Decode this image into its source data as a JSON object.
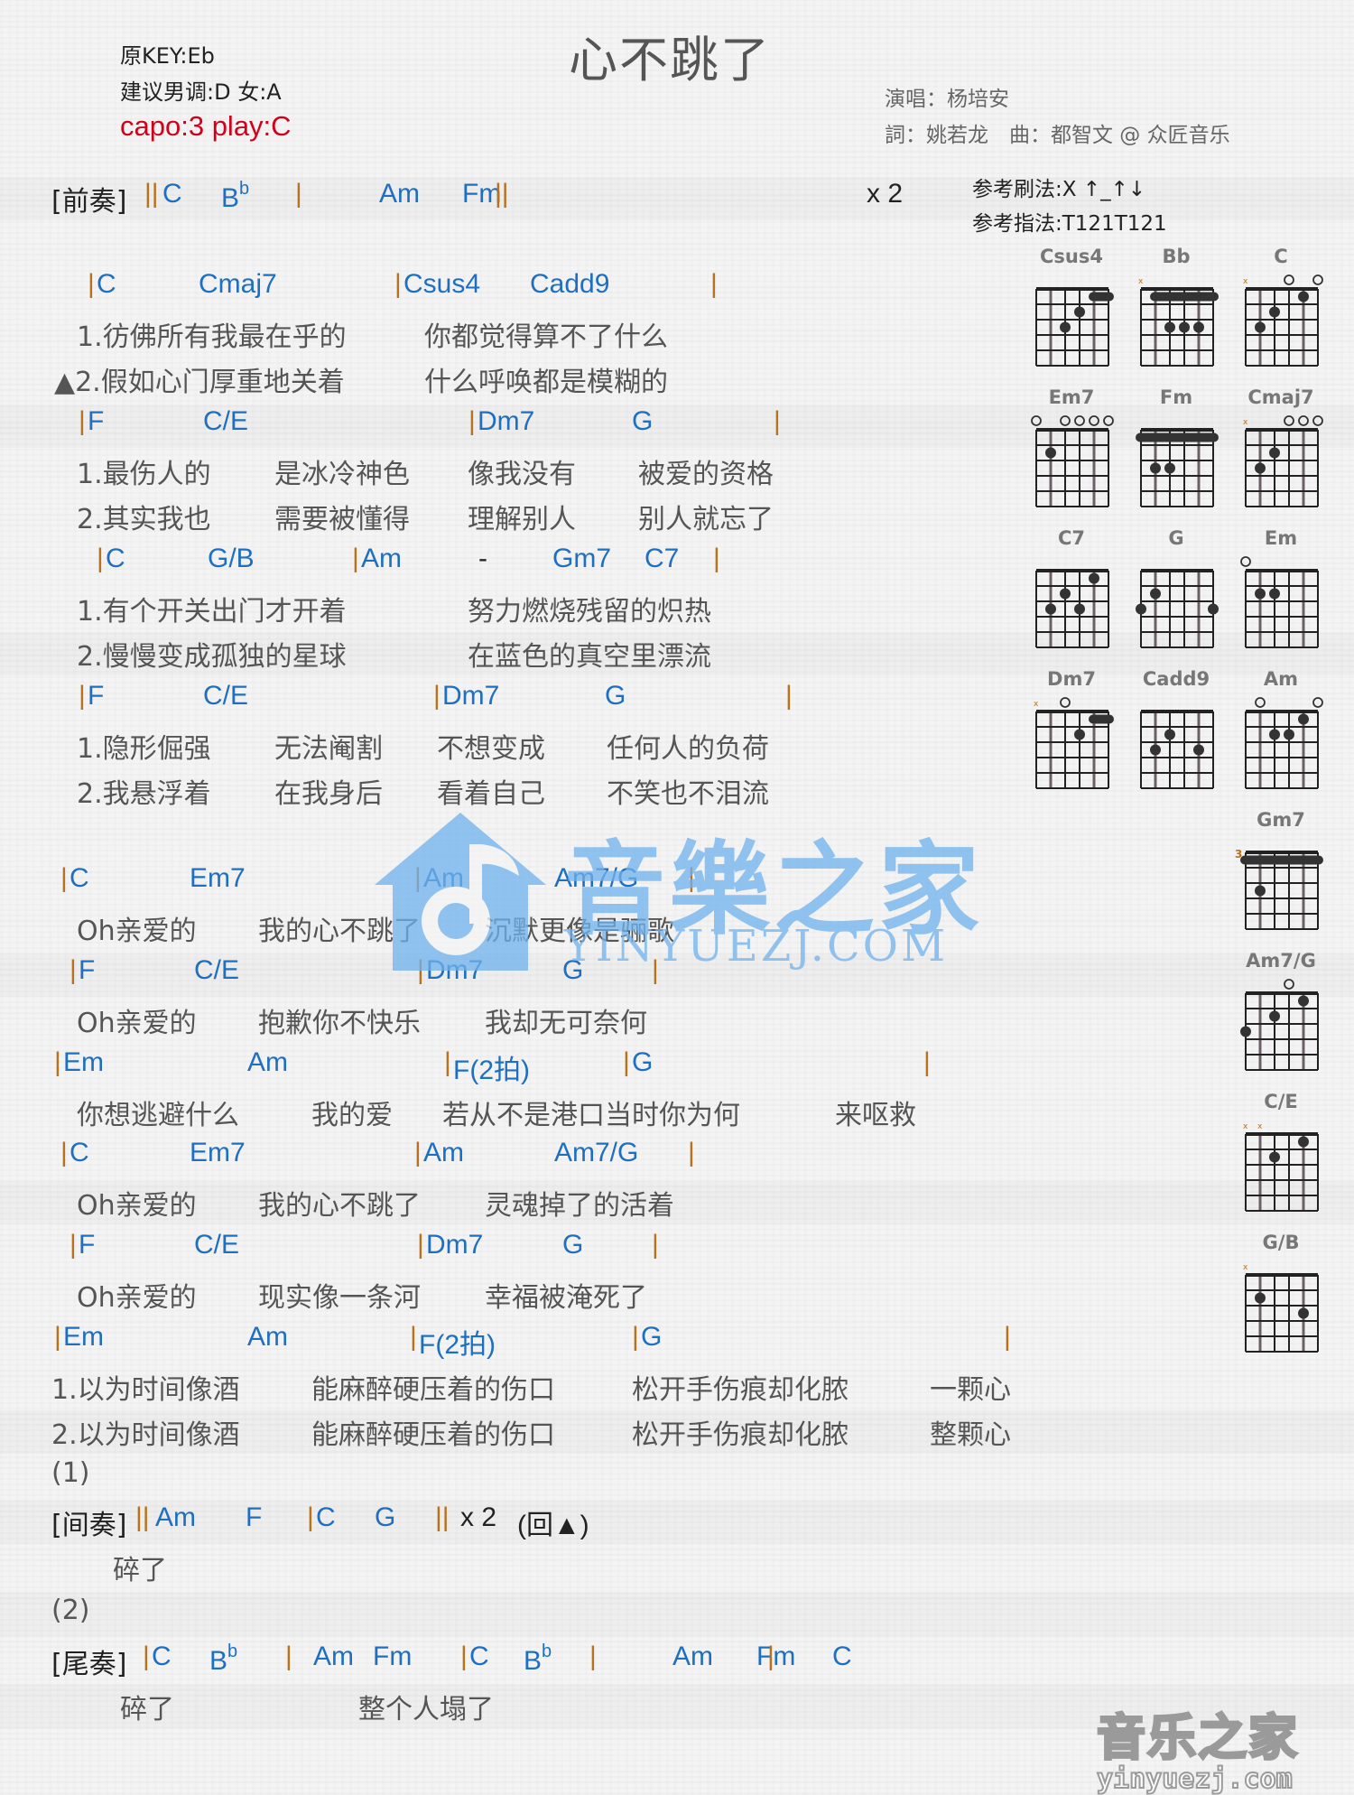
{
  "header": {
    "original_key": "原KEY:Eb",
    "suggested_key": "建议男调:D 女:A",
    "capo": "capo:3 play:C",
    "title": "心不跳了",
    "singer": "演唱：杨培安",
    "credits": "詞：姚若龙　曲：都智文 @ 众匠音乐",
    "strum": "参考刷法:X ↑_↑↓",
    "finger": "参考指法:T121T121"
  },
  "colors": {
    "chord": "#1f6fc1",
    "bar": "#b8721e",
    "capo": "#d0021b",
    "lyric": "#555555",
    "watermark": "#6fb2ee"
  },
  "sections": {
    "intro": {
      "label": "[前奏]",
      "repeat": "x 2"
    },
    "interlude": {
      "label": "[间奏]",
      "repeat": "x 2",
      "back": "(回▲)"
    },
    "outro": {
      "label": "[尾奏]"
    },
    "mark1": "(1)",
    "mark2": "(2)"
  },
  "lines": [
    {
      "type": "intro",
      "tokens": [
        [
          "label",
          "[前奏]"
        ],
        [
          "bar",
          "||"
        ],
        [
          "chord",
          "C"
        ],
        [
          "chord",
          "B",
          "b"
        ],
        [
          "bar",
          "|"
        ],
        [
          "chord",
          "Am"
        ],
        [
          "chord",
          "Fm"
        ],
        [
          "bar",
          "||"
        ],
        [
          "plain",
          "x 2"
        ]
      ]
    },
    {
      "type": "chord",
      "tokens": [
        [
          "bar",
          "|"
        ],
        [
          "chord",
          "C"
        ],
        [
          "chord",
          "Cmaj7"
        ],
        [
          "bar",
          "|"
        ],
        [
          "chord",
          "Csus4"
        ],
        [
          "chord",
          "Cadd9"
        ],
        [
          "bar",
          "|"
        ]
      ]
    },
    {
      "type": "lyric",
      "tokens": [
        [
          "lyric",
          "1.彷佛所有我最在乎的"
        ],
        [
          "lyric",
          "你都觉得算不了什么"
        ]
      ]
    },
    {
      "type": "lyric",
      "tokens": [
        [
          "lyric",
          "▲2.假如心门厚重地关着"
        ],
        [
          "lyric",
          "什么呼唤都是模糊的"
        ]
      ]
    },
    {
      "type": "chord",
      "tokens": [
        [
          "bar",
          "|"
        ],
        [
          "chord",
          "F"
        ],
        [
          "chord",
          "C/E"
        ],
        [
          "bar",
          "|"
        ],
        [
          "chord",
          "Dm7"
        ],
        [
          "chord",
          "G"
        ],
        [
          "bar",
          "|"
        ]
      ]
    },
    {
      "type": "lyric",
      "tokens": [
        [
          "lyric",
          "1.最伤人的"
        ],
        [
          "lyric",
          "是冰冷神色"
        ],
        [
          "lyric",
          "像我没有"
        ],
        [
          "lyric",
          "被爱的资格"
        ]
      ]
    },
    {
      "type": "lyric",
      "tokens": [
        [
          "lyric",
          "2.其实我也"
        ],
        [
          "lyric",
          "需要被懂得"
        ],
        [
          "lyric",
          "理解别人"
        ],
        [
          "lyric",
          "别人就忘了"
        ]
      ]
    },
    {
      "type": "chord",
      "tokens": [
        [
          "bar",
          "|"
        ],
        [
          "chord",
          "C"
        ],
        [
          "chord",
          "G/B"
        ],
        [
          "bar",
          "|"
        ],
        [
          "chord",
          "Am"
        ],
        [
          "plain",
          "-"
        ],
        [
          "chord",
          "Gm7"
        ],
        [
          "chord",
          "C7"
        ],
        [
          "bar",
          "|"
        ]
      ]
    },
    {
      "type": "lyric",
      "tokens": [
        [
          "lyric",
          "1.有个开关出门才开着"
        ],
        [
          "lyric",
          "努力燃烧残留的炽热"
        ]
      ]
    },
    {
      "type": "lyric",
      "tokens": [
        [
          "lyric",
          "2.慢慢变成孤独的星球"
        ],
        [
          "lyric",
          "在蓝色的真空里漂流"
        ]
      ]
    },
    {
      "type": "chord",
      "tokens": [
        [
          "bar",
          "|"
        ],
        [
          "chord",
          "F"
        ],
        [
          "chord",
          "C/E"
        ],
        [
          "bar",
          "|"
        ],
        [
          "chord",
          "Dm7"
        ],
        [
          "chord",
          "G"
        ],
        [
          "bar",
          "|"
        ]
      ]
    },
    {
      "type": "lyric",
      "tokens": [
        [
          "lyric",
          "1.隐形倔强"
        ],
        [
          "lyric",
          "无法阉割"
        ],
        [
          "lyric",
          "不想变成"
        ],
        [
          "lyric",
          "任何人的负荷"
        ]
      ]
    },
    {
      "type": "lyric",
      "tokens": [
        [
          "lyric",
          "2.我悬浮着"
        ],
        [
          "lyric",
          "在我身后"
        ],
        [
          "lyric",
          "看着自己"
        ],
        [
          "lyric",
          "不笑也不泪流"
        ]
      ]
    },
    {
      "type": "chord",
      "tokens": [
        [
          "bar",
          "|"
        ],
        [
          "chord",
          "C"
        ],
        [
          "chord",
          "Em7"
        ],
        [
          "bar",
          "|"
        ],
        [
          "chord",
          "Am"
        ],
        [
          "chord",
          "Am7/G"
        ],
        [
          "bar",
          "|"
        ]
      ]
    },
    {
      "type": "lyric",
      "tokens": [
        [
          "lyric",
          "Oh亲爱的"
        ],
        [
          "lyric",
          "我的心不跳了"
        ],
        [
          "lyric",
          "沉默更像是骊歌"
        ]
      ]
    },
    {
      "type": "chord",
      "tokens": [
        [
          "bar",
          "|"
        ],
        [
          "chord",
          "F"
        ],
        [
          "chord",
          "C/E"
        ],
        [
          "bar",
          "|"
        ],
        [
          "chord",
          "Dm7"
        ],
        [
          "chord",
          "G"
        ],
        [
          "bar",
          "|"
        ]
      ]
    },
    {
      "type": "lyric",
      "tokens": [
        [
          "lyric",
          "Oh亲爱的"
        ],
        [
          "lyric",
          "抱歉你不快乐"
        ],
        [
          "lyric",
          "我却无可奈何"
        ]
      ]
    },
    {
      "type": "chord",
      "tokens": [
        [
          "bar",
          "|"
        ],
        [
          "chord",
          "Em"
        ],
        [
          "chord",
          "Am"
        ],
        [
          "bar",
          "|"
        ],
        [
          "chord",
          "F(2拍)"
        ],
        [
          "bar",
          "|"
        ],
        [
          "chord",
          "G"
        ],
        [
          "bar",
          "|"
        ]
      ]
    },
    {
      "type": "lyric",
      "tokens": [
        [
          "lyric",
          "你想逃避什么"
        ],
        [
          "lyric",
          "我的爱"
        ],
        [
          "lyric",
          "若从不是港口当时你为何"
        ],
        [
          "lyric",
          "来呕救"
        ]
      ]
    },
    {
      "type": "chord",
      "tokens": [
        [
          "bar",
          "|"
        ],
        [
          "chord",
          "C"
        ],
        [
          "chord",
          "Em7"
        ],
        [
          "bar",
          "|"
        ],
        [
          "chord",
          "Am"
        ],
        [
          "chord",
          "Am7/G"
        ],
        [
          "bar",
          "|"
        ]
      ]
    },
    {
      "type": "lyric",
      "tokens": [
        [
          "lyric",
          "Oh亲爱的"
        ],
        [
          "lyric",
          "我的心不跳了"
        ],
        [
          "lyric",
          "灵魂掉了的活着"
        ]
      ]
    },
    {
      "type": "chord",
      "tokens": [
        [
          "bar",
          "|"
        ],
        [
          "chord",
          "F"
        ],
        [
          "chord",
          "C/E"
        ],
        [
          "bar",
          "|"
        ],
        [
          "chord",
          "Dm7"
        ],
        [
          "chord",
          "G"
        ],
        [
          "bar",
          "|"
        ]
      ]
    },
    {
      "type": "lyric",
      "tokens": [
        [
          "lyric",
          "Oh亲爱的"
        ],
        [
          "lyric",
          "现实像一条河"
        ],
        [
          "lyric",
          "幸福被淹死了"
        ]
      ]
    },
    {
      "type": "chord",
      "tokens": [
        [
          "bar",
          "|"
        ],
        [
          "chord",
          "Em"
        ],
        [
          "chord",
          "Am"
        ],
        [
          "bar",
          "|"
        ],
        [
          "chord",
          "F(2拍)"
        ],
        [
          "bar",
          "|"
        ],
        [
          "chord",
          "G"
        ],
        [
          "bar",
          "|"
        ]
      ]
    },
    {
      "type": "lyric",
      "tokens": [
        [
          "lyric",
          "1.以为时间像酒"
        ],
        [
          "lyric",
          "能麻醉硬压着的伤口"
        ],
        [
          "lyric",
          "松开手伤痕却化脓"
        ],
        [
          "lyric",
          "一颗心"
        ]
      ]
    },
    {
      "type": "lyric",
      "tokens": [
        [
          "lyric",
          "2.以为时间像酒"
        ],
        [
          "lyric",
          "能麻醉硬压着的伤口"
        ],
        [
          "lyric",
          "松开手伤痕却化脓"
        ],
        [
          "lyric",
          "整颗心"
        ]
      ]
    },
    {
      "type": "mark",
      "tokens": [
        [
          "lyric",
          "(1)"
        ]
      ]
    },
    {
      "type": "interlude",
      "tokens": [
        [
          "label",
          "[间奏]"
        ],
        [
          "bar",
          "||"
        ],
        [
          "chord",
          "Am"
        ],
        [
          "chord",
          "F"
        ],
        [
          "bar",
          "|"
        ],
        [
          "chord",
          "C"
        ],
        [
          "chord",
          "G"
        ],
        [
          "bar",
          "||"
        ],
        [
          "plain",
          "x 2"
        ],
        [
          "plain",
          "(回▲)"
        ]
      ]
    },
    {
      "type": "lyric",
      "tokens": [
        [
          "lyric",
          "碎了"
        ]
      ]
    },
    {
      "type": "mark",
      "tokens": [
        [
          "lyric",
          "(2)"
        ]
      ]
    },
    {
      "type": "outro",
      "tokens": [
        [
          "label",
          "[尾奏]"
        ],
        [
          "bar",
          "|"
        ],
        [
          "chord",
          "C"
        ],
        [
          "chord",
          "B",
          "b"
        ],
        [
          "bar",
          "|"
        ],
        [
          "chord",
          "Am"
        ],
        [
          "chord",
          "Fm"
        ],
        [
          "bar",
          "|"
        ],
        [
          "chord",
          "C"
        ],
        [
          "chord",
          "B",
          "b"
        ],
        [
          "bar",
          "|"
        ],
        [
          "chord",
          "Am"
        ],
        [
          "chord",
          "Fm"
        ],
        [
          "bar",
          "|"
        ],
        [
          "chord",
          "C"
        ],
        [
          "bar",
          "|"
        ]
      ]
    },
    {
      "type": "lyric",
      "tokens": [
        [
          "lyric",
          "碎了"
        ],
        [
          "lyric",
          "整个人塌了"
        ]
      ]
    }
  ],
  "chord_diagrams": [
    {
      "name": "Csus4",
      "top": [
        "",
        "",
        "",
        "",
        "",
        ""
      ],
      "barre": [
        1,
        4,
        5
      ],
      "dots": [
        [
          3,
          2
        ],
        [
          2,
          3
        ]
      ]
    },
    {
      "name": "Bb",
      "top": [
        "x",
        "",
        "",
        "",
        "",
        ""
      ],
      "barre": [
        1,
        1,
        5
      ],
      "dots": [
        [
          2,
          3
        ],
        [
          3,
          3
        ],
        [
          4,
          3
        ]
      ]
    },
    {
      "name": "C",
      "top": [
        "x",
        "",
        "",
        "o",
        "",
        "o"
      ],
      "barre": null,
      "dots": [
        [
          1,
          3
        ],
        [
          2,
          2
        ],
        [
          4,
          1
        ]
      ]
    },
    {
      "name": "Em7",
      "top": [
        "o",
        "",
        "o",
        "o",
        "o",
        "o"
      ],
      "barre": null,
      "dots": [
        [
          1,
          2
        ]
      ]
    },
    {
      "name": "Fm",
      "top": [
        "",
        "",
        "",
        "",
        "",
        ""
      ],
      "barre": [
        1,
        0,
        5
      ],
      "dots": [
        [
          1,
          3
        ],
        [
          2,
          3
        ]
      ]
    },
    {
      "name": "Cmaj7",
      "top": [
        "x",
        "",
        "",
        "o",
        "o",
        "o"
      ],
      "barre": null,
      "dots": [
        [
          1,
          3
        ],
        [
          2,
          2
        ]
      ]
    },
    {
      "name": "C7",
      "top": [
        "",
        "",
        "",
        "",
        "",
        ""
      ],
      "barre": null,
      "dots": [
        [
          1,
          3
        ],
        [
          2,
          2
        ],
        [
          3,
          3
        ],
        [
          4,
          1
        ]
      ]
    },
    {
      "name": "G",
      "top": [
        "",
        "",
        "",
        "",
        "",
        ""
      ],
      "barre": null,
      "dots": [
        [
          0,
          3
        ],
        [
          1,
          2
        ],
        [
          5,
          3
        ]
      ]
    },
    {
      "name": "Em",
      "top": [
        "o",
        "",
        "",
        "",
        "",
        ""
      ],
      "barre": null,
      "dots": [
        [
          1,
          2
        ],
        [
          2,
          2
        ]
      ]
    },
    {
      "name": "Dm7",
      "top": [
        "x",
        "",
        "o",
        "",
        "",
        ""
      ],
      "barre": [
        1,
        4,
        5
      ],
      "dots": [
        [
          3,
          2
        ]
      ]
    },
    {
      "name": "Cadd9",
      "top": [
        "",
        "",
        "",
        "",
        "",
        ""
      ],
      "barre": null,
      "dots": [
        [
          1,
          3
        ],
        [
          2,
          2
        ],
        [
          4,
          3
        ]
      ]
    },
    {
      "name": "Am",
      "top": [
        "",
        "o",
        "",
        "",
        "",
        "o"
      ],
      "barre": null,
      "dots": [
        [
          2,
          2
        ],
        [
          3,
          2
        ],
        [
          4,
          1
        ]
      ]
    },
    {
      "name": "Gm7",
      "top": [
        "",
        "",
        "",
        "",
        "",
        ""
      ],
      "barre": [
        1,
        0,
        5
      ],
      "fret": "3",
      "dots": [
        [
          1,
          3
        ]
      ]
    },
    {
      "name": "Am7/G",
      "top": [
        "",
        "",
        "",
        "o",
        "",
        ""
      ],
      "barre": null,
      "dots": [
        [
          0,
          3
        ],
        [
          2,
          2
        ],
        [
          4,
          1
        ]
      ]
    },
    {
      "name": "C/E",
      "top": [
        "x",
        "x",
        "",
        "",
        "",
        ""
      ],
      "barre": null,
      "dots": [
        [
          2,
          2
        ],
        [
          4,
          1
        ]
      ]
    },
    {
      "name": "G/B",
      "top": [
        "x",
        "",
        "",
        "",
        "",
        ""
      ],
      "barre": null,
      "dots": [
        [
          1,
          2
        ],
        [
          4,
          3
        ]
      ]
    }
  ],
  "watermark": {
    "cn": "音樂之家",
    "en": "YINYUEZJ.COM"
  },
  "footer_logo": {
    "cn": "音乐之家",
    "en": "yinyuezj.com"
  }
}
